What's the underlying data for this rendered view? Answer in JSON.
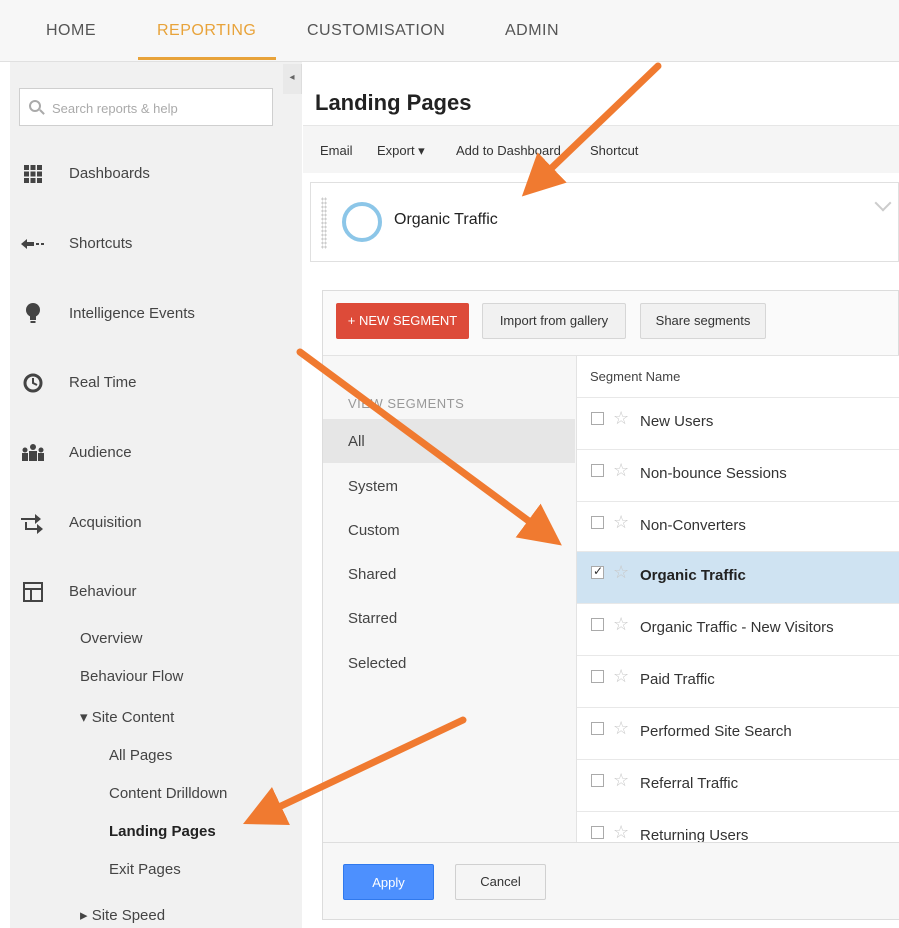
{
  "topnav": {
    "tabs": [
      {
        "label": "HOME"
      },
      {
        "label": "REPORTING"
      },
      {
        "label": "CUSTOMISATION"
      },
      {
        "label": "ADMIN"
      }
    ],
    "active": "REPORTING",
    "accent_color": "#e8a33a"
  },
  "sidebar": {
    "collapse_icon": "caret-left-icon",
    "search_placeholder": "Search reports & help",
    "items": [
      {
        "label": "Dashboards",
        "icon": "grid-icon"
      },
      {
        "label": "Shortcuts",
        "icon": "arrow-left-icon"
      },
      {
        "label": "Intelligence Events",
        "icon": "lightbulb-icon"
      },
      {
        "label": "Real Time",
        "icon": "clock-icon"
      },
      {
        "label": "Audience",
        "icon": "people-icon"
      },
      {
        "label": "Acquisition",
        "icon": "arrows-icon"
      },
      {
        "label": "Behaviour",
        "icon": "layout-icon"
      }
    ],
    "behaviour_sub": {
      "overview": "Overview",
      "flow": "Behaviour Flow",
      "site_content": "▾ Site Content",
      "all_pages": "All Pages",
      "drilldown": "Content Drilldown",
      "landing": "Landing Pages",
      "exit": "Exit Pages",
      "site_speed": "▸ Site Speed"
    }
  },
  "main": {
    "title": "Landing Pages",
    "toolbar": {
      "email": "Email",
      "export": "Export ▾",
      "add_dashboard": "Add to Dashboard",
      "shortcut": "Shortcut"
    },
    "segment_chip": {
      "name": "Organic Traffic"
    },
    "segments_panel": {
      "new_segment": "+ NEW SEGMENT",
      "import": "Import from gallery",
      "share": "Share segments",
      "view_segments_header": "VIEW SEGMENTS",
      "categories": [
        "All",
        "System",
        "Custom",
        "Shared",
        "Starred",
        "Selected"
      ],
      "selected_category": "All",
      "list_header": "Segment Name",
      "segments": [
        {
          "name": "New Users",
          "checked": false
        },
        {
          "name": "Non-bounce Sessions",
          "checked": false
        },
        {
          "name": "Non-Converters",
          "checked": false
        },
        {
          "name": "Organic Traffic",
          "checked": true
        },
        {
          "name": "Organic Traffic - New Visitors",
          "checked": false
        },
        {
          "name": "Paid Traffic",
          "checked": false
        },
        {
          "name": "Performed Site Search",
          "checked": false
        },
        {
          "name": "Referral Traffic",
          "checked": false
        },
        {
          "name": "Returning Users",
          "checked": false
        }
      ],
      "apply": "Apply",
      "cancel": "Cancel"
    }
  },
  "colors": {
    "new_segment_button": "#dd4b39",
    "apply_button": "#4d90fe",
    "selected_row": "#cfe3f2",
    "annotation_arrow": "#f07a30"
  }
}
